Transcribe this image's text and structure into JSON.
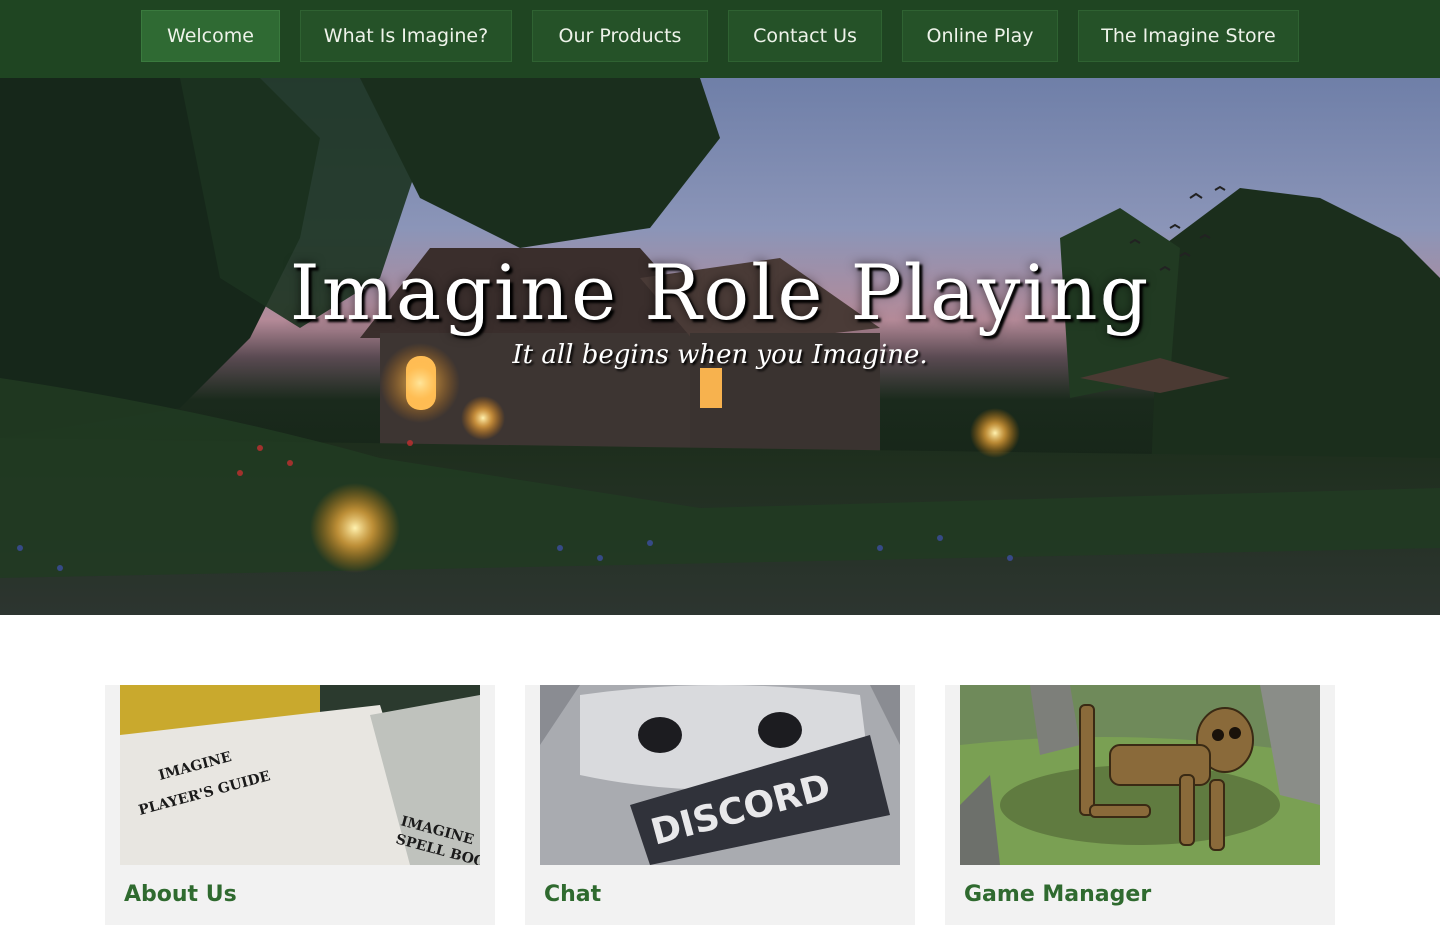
{
  "nav": {
    "items": [
      {
        "label": "Welcome",
        "active": true
      },
      {
        "label": "What Is Imagine?"
      },
      {
        "label": "Our Products"
      },
      {
        "label": "Contact Us"
      },
      {
        "label": "Online Play"
      },
      {
        "label": "The Imagine Store"
      }
    ]
  },
  "hero": {
    "title": "Imagine Role Playing",
    "subtitle": "It all begins when you Imagine."
  },
  "cards": [
    {
      "title": "About Us",
      "image": "players-guide-books-image"
    },
    {
      "title": "Chat",
      "image": "discord-logo-image"
    },
    {
      "title": "Game Manager",
      "image": "skeleton-image"
    }
  ],
  "colors": {
    "nav_bg": "#1f4522",
    "nav_button": "#255228",
    "nav_active": "#2f6a33",
    "card_title": "#2f6a2f",
    "card_bg": "#f2f2f2"
  }
}
